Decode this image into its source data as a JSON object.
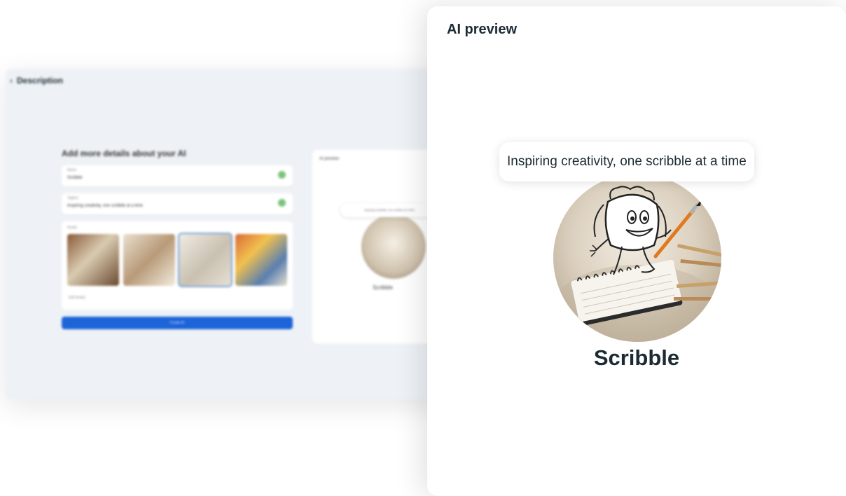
{
  "background_window": {
    "header": "Description",
    "form_title": "Add more details about your AI",
    "name_field": {
      "label": "Name",
      "value": "Scribble"
    },
    "tagline_field": {
      "label": "Tagline",
      "value": "Inspiring creativity, one scribble at a time"
    },
    "avatar_section": {
      "label": "Avatar",
      "edit_label": "Edit Avatar"
    },
    "create_button": "Create AI",
    "preview_card": {
      "title": "AI preview",
      "tagline": "Inspiring creativity, one scribble at a time",
      "name": "Scribble"
    }
  },
  "preview": {
    "title": "AI preview",
    "tagline": "Inspiring creativity, one scribble at a time",
    "name": "Scribble",
    "avatar_icon": "scribble-character-avatar"
  },
  "colors": {
    "primary_button": "#1d64d8",
    "text": "#1c2b33",
    "background_window": "#eef2f6",
    "check": "#7ac27a"
  }
}
